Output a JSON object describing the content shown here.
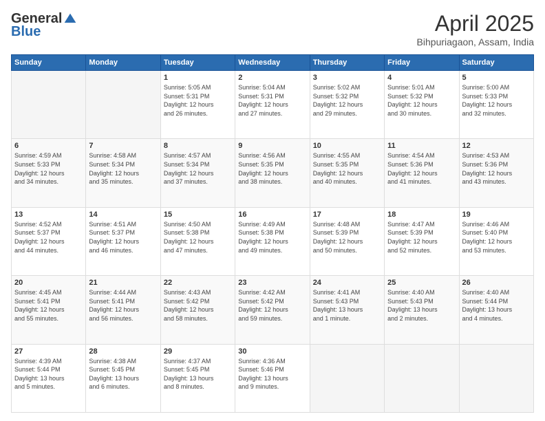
{
  "header": {
    "logo_general": "General",
    "logo_blue": "Blue",
    "title": "April 2025",
    "subtitle": "Bihpuriagaon, Assam, India"
  },
  "days_of_week": [
    "Sunday",
    "Monday",
    "Tuesday",
    "Wednesday",
    "Thursday",
    "Friday",
    "Saturday"
  ],
  "weeks": [
    [
      {
        "day": "",
        "info": ""
      },
      {
        "day": "",
        "info": ""
      },
      {
        "day": "1",
        "info": "Sunrise: 5:05 AM\nSunset: 5:31 PM\nDaylight: 12 hours\nand 26 minutes."
      },
      {
        "day": "2",
        "info": "Sunrise: 5:04 AM\nSunset: 5:31 PM\nDaylight: 12 hours\nand 27 minutes."
      },
      {
        "day": "3",
        "info": "Sunrise: 5:02 AM\nSunset: 5:32 PM\nDaylight: 12 hours\nand 29 minutes."
      },
      {
        "day": "4",
        "info": "Sunrise: 5:01 AM\nSunset: 5:32 PM\nDaylight: 12 hours\nand 30 minutes."
      },
      {
        "day": "5",
        "info": "Sunrise: 5:00 AM\nSunset: 5:33 PM\nDaylight: 12 hours\nand 32 minutes."
      }
    ],
    [
      {
        "day": "6",
        "info": "Sunrise: 4:59 AM\nSunset: 5:33 PM\nDaylight: 12 hours\nand 34 minutes."
      },
      {
        "day": "7",
        "info": "Sunrise: 4:58 AM\nSunset: 5:34 PM\nDaylight: 12 hours\nand 35 minutes."
      },
      {
        "day": "8",
        "info": "Sunrise: 4:57 AM\nSunset: 5:34 PM\nDaylight: 12 hours\nand 37 minutes."
      },
      {
        "day": "9",
        "info": "Sunrise: 4:56 AM\nSunset: 5:35 PM\nDaylight: 12 hours\nand 38 minutes."
      },
      {
        "day": "10",
        "info": "Sunrise: 4:55 AM\nSunset: 5:35 PM\nDaylight: 12 hours\nand 40 minutes."
      },
      {
        "day": "11",
        "info": "Sunrise: 4:54 AM\nSunset: 5:36 PM\nDaylight: 12 hours\nand 41 minutes."
      },
      {
        "day": "12",
        "info": "Sunrise: 4:53 AM\nSunset: 5:36 PM\nDaylight: 12 hours\nand 43 minutes."
      }
    ],
    [
      {
        "day": "13",
        "info": "Sunrise: 4:52 AM\nSunset: 5:37 PM\nDaylight: 12 hours\nand 44 minutes."
      },
      {
        "day": "14",
        "info": "Sunrise: 4:51 AM\nSunset: 5:37 PM\nDaylight: 12 hours\nand 46 minutes."
      },
      {
        "day": "15",
        "info": "Sunrise: 4:50 AM\nSunset: 5:38 PM\nDaylight: 12 hours\nand 47 minutes."
      },
      {
        "day": "16",
        "info": "Sunrise: 4:49 AM\nSunset: 5:38 PM\nDaylight: 12 hours\nand 49 minutes."
      },
      {
        "day": "17",
        "info": "Sunrise: 4:48 AM\nSunset: 5:39 PM\nDaylight: 12 hours\nand 50 minutes."
      },
      {
        "day": "18",
        "info": "Sunrise: 4:47 AM\nSunset: 5:39 PM\nDaylight: 12 hours\nand 52 minutes."
      },
      {
        "day": "19",
        "info": "Sunrise: 4:46 AM\nSunset: 5:40 PM\nDaylight: 12 hours\nand 53 minutes."
      }
    ],
    [
      {
        "day": "20",
        "info": "Sunrise: 4:45 AM\nSunset: 5:41 PM\nDaylight: 12 hours\nand 55 minutes."
      },
      {
        "day": "21",
        "info": "Sunrise: 4:44 AM\nSunset: 5:41 PM\nDaylight: 12 hours\nand 56 minutes."
      },
      {
        "day": "22",
        "info": "Sunrise: 4:43 AM\nSunset: 5:42 PM\nDaylight: 12 hours\nand 58 minutes."
      },
      {
        "day": "23",
        "info": "Sunrise: 4:42 AM\nSunset: 5:42 PM\nDaylight: 12 hours\nand 59 minutes."
      },
      {
        "day": "24",
        "info": "Sunrise: 4:41 AM\nSunset: 5:43 PM\nDaylight: 13 hours\nand 1 minute."
      },
      {
        "day": "25",
        "info": "Sunrise: 4:40 AM\nSunset: 5:43 PM\nDaylight: 13 hours\nand 2 minutes."
      },
      {
        "day": "26",
        "info": "Sunrise: 4:40 AM\nSunset: 5:44 PM\nDaylight: 13 hours\nand 4 minutes."
      }
    ],
    [
      {
        "day": "27",
        "info": "Sunrise: 4:39 AM\nSunset: 5:44 PM\nDaylight: 13 hours\nand 5 minutes."
      },
      {
        "day": "28",
        "info": "Sunrise: 4:38 AM\nSunset: 5:45 PM\nDaylight: 13 hours\nand 6 minutes."
      },
      {
        "day": "29",
        "info": "Sunrise: 4:37 AM\nSunset: 5:45 PM\nDaylight: 13 hours\nand 8 minutes."
      },
      {
        "day": "30",
        "info": "Sunrise: 4:36 AM\nSunset: 5:46 PM\nDaylight: 13 hours\nand 9 minutes."
      },
      {
        "day": "",
        "info": ""
      },
      {
        "day": "",
        "info": ""
      },
      {
        "day": "",
        "info": ""
      }
    ]
  ]
}
